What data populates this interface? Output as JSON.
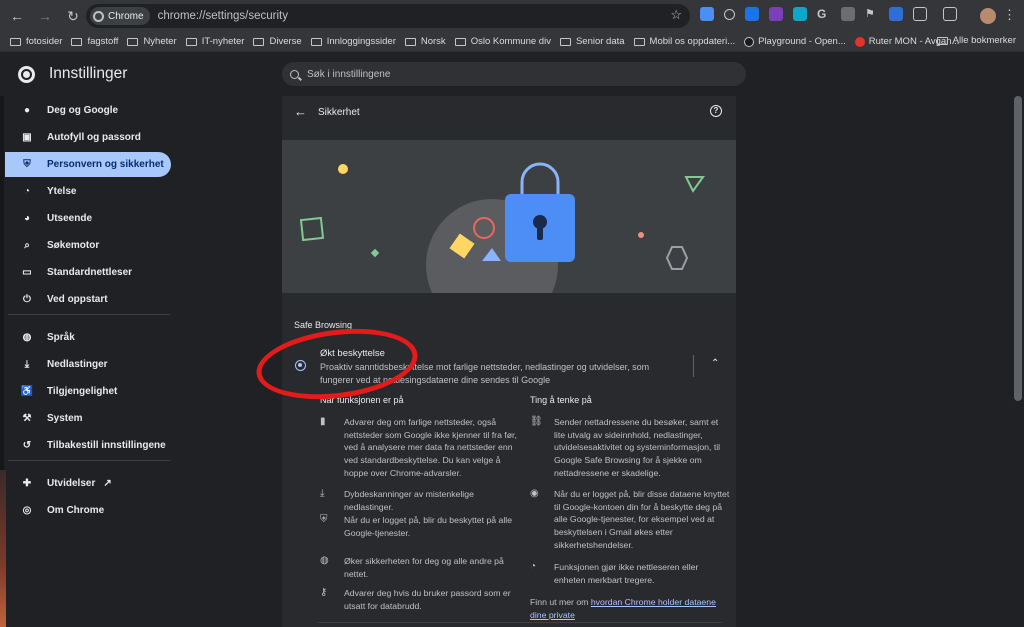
{
  "browser": {
    "site_chip": "Chrome",
    "url": "chrome://settings/security",
    "bookmarks": [
      "fotosider",
      "fagstoff",
      "Nyheter",
      "IT-nyheter",
      "Diverse",
      "Innloggingssider",
      "Norsk",
      "Oslo Kommune div",
      "Senior data",
      "Mobil os oppdateri..."
    ],
    "bookmark_playground": "Playground - Open...",
    "bookmark_ruter": "Ruter MON - Avgan...",
    "all_bookmarks": "Alle bokmerker"
  },
  "header": {
    "title": "Innstillinger",
    "search_placeholder": "Søk i innstillingene"
  },
  "sidebar": {
    "items": [
      {
        "label": "Deg og Google",
        "icon": "person-icon"
      },
      {
        "label": "Autofyll og passord",
        "icon": "clipboard-icon"
      },
      {
        "label": "Personvern og sikkerhet",
        "icon": "shield-icon"
      },
      {
        "label": "Ytelse",
        "icon": "gauge-icon"
      },
      {
        "label": "Utseende",
        "icon": "palette-icon"
      },
      {
        "label": "Søkemotor",
        "icon": "search-icon"
      },
      {
        "label": "Standardnettleser",
        "icon": "browser-icon"
      },
      {
        "label": "Ved oppstart",
        "icon": "power-icon"
      },
      {
        "label": "Språk",
        "icon": "globe-icon"
      },
      {
        "label": "Nedlastinger",
        "icon": "download-icon"
      },
      {
        "label": "Tilgjengelighet",
        "icon": "accessibility-icon"
      },
      {
        "label": "System",
        "icon": "wrench-icon"
      },
      {
        "label": "Tilbakestill innstillingene",
        "icon": "restore-icon"
      },
      {
        "label": "Utvidelser",
        "icon": "puzzle-icon"
      },
      {
        "label": "Om Chrome",
        "icon": "chrome-icon"
      }
    ]
  },
  "page": {
    "title": "Sikkerhet",
    "section_label": "Safe Browsing",
    "option_title": "Økt beskyttelse",
    "option_desc": "Proaktiv sanntidsbeskyttelse mot farlige nettsteder, nedlastinger og utvidelser, som fungerer ved at nettlesingsdataene dine sendes til Google",
    "left_heading": "Når funksjonen er på",
    "right_heading": "Ting å tenke på",
    "left_features": [
      {
        "icon": "bar-chart-icon",
        "text": "Advarer deg om farlige nettsteder, også nettsteder som Google ikke kjenner til fra før, ved å analysere mer data fra nettsteder enn ved standardbeskyttelse. Du kan velge å hoppe over Chrome-advarsler."
      },
      {
        "icon": "download-icon",
        "text": "Dybdeskanninger av mistenkelige nedlastinger."
      },
      {
        "icon": "google-shield-icon",
        "text": "Når du er logget på, blir du beskyttet på alle Google-tjenester."
      },
      {
        "icon": "globe-icon",
        "text": "Øker sikkerheten for deg og alle andre på nettet."
      },
      {
        "icon": "key-icon",
        "text": "Advarer deg hvis du bruker passord som er utsatt for databrudd."
      }
    ],
    "right_features": [
      {
        "icon": "link-icon",
        "text": "Sender nettadressene du besøker, samt et lite utvalg av sideinnhold, nedlastinger, utvidelsesaktivitet og systeminformasjon, til Google Safe Browsing for å sjekke om nettadressene er skadelige."
      },
      {
        "icon": "account-icon",
        "text": "Når du er logget på, blir disse dataene knyttet til Google-kontoen din for å beskytte deg på alle Google-tjenester, for eksempel ved at beskyttelsen i Gmail økes etter sikkerhetshendelser."
      },
      {
        "icon": "speed-icon",
        "text": "Funksjonen gjør ikke nettleseren eller enheten merkbart tregere."
      }
    ],
    "learn_more_prefix": "Finn ut mer om ",
    "learn_more_link": "hvordan Chrome holder dataene dine private"
  },
  "colors": {
    "accent": "#a8c7fa",
    "annotation": "#e31b1b",
    "lock": "#4c8df6"
  }
}
